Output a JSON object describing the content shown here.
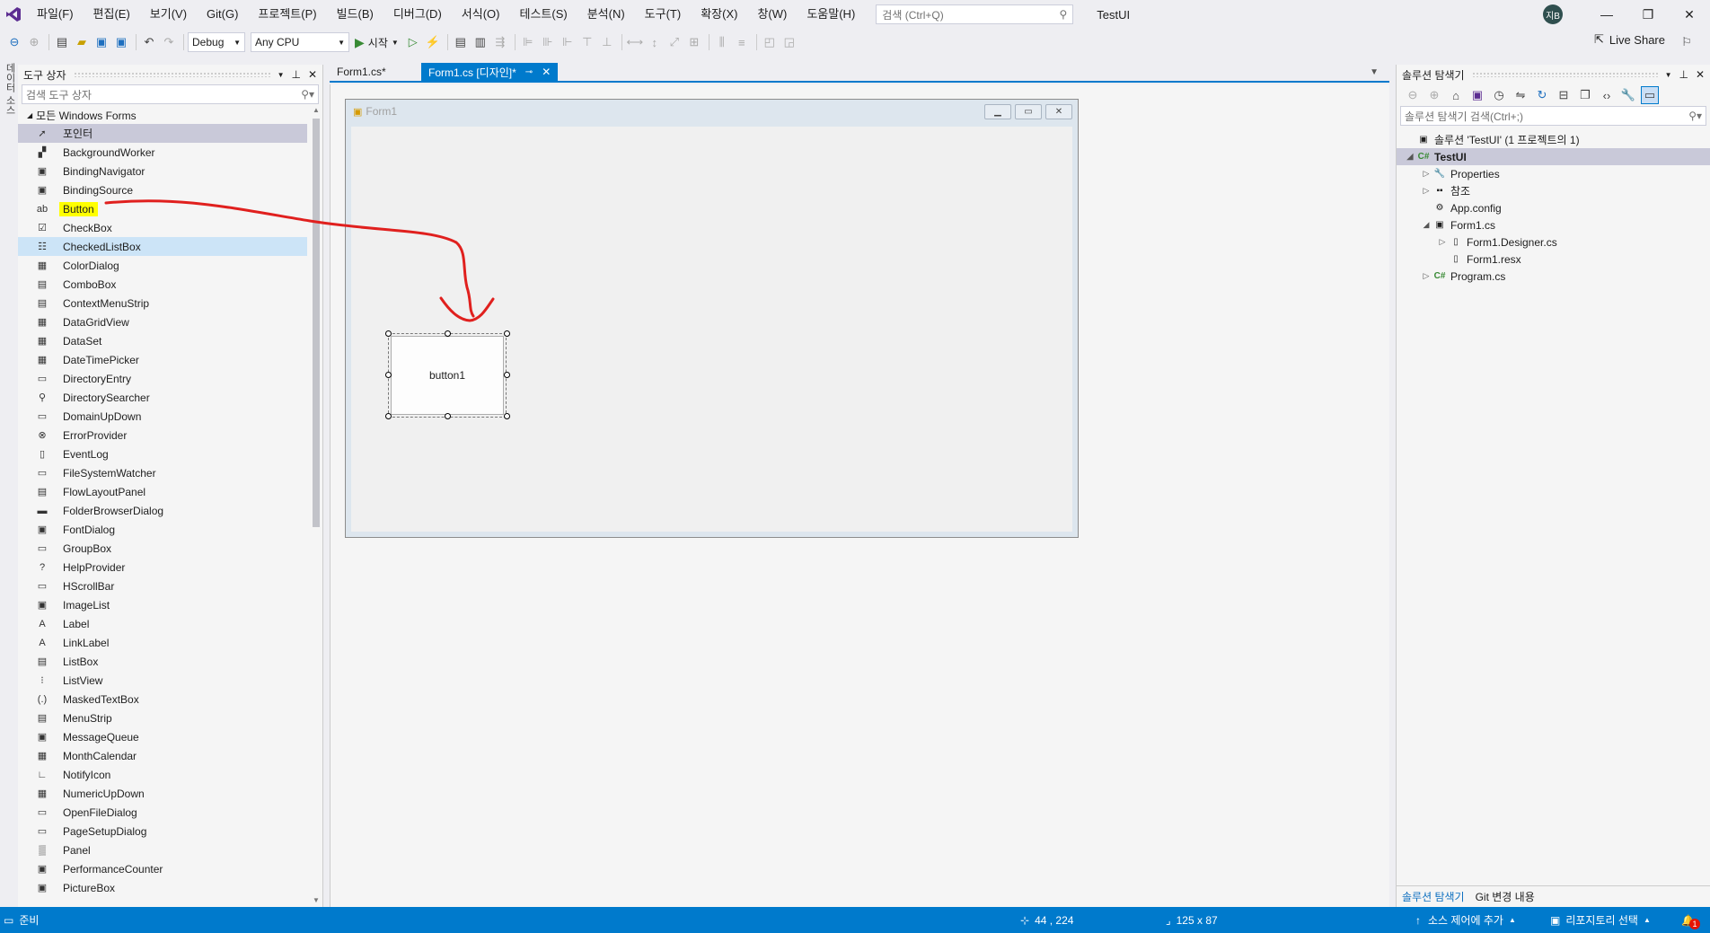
{
  "menu": {
    "items": [
      "파일(F)",
      "편집(E)",
      "보기(V)",
      "Git(G)",
      "프로젝트(P)",
      "빌드(B)",
      "디버그(D)",
      "서식(O)",
      "테스트(S)",
      "분석(N)",
      "도구(T)",
      "확장(X)",
      "창(W)",
      "도움말(H)"
    ],
    "search_placeholder": "검색 (Ctrl+Q)",
    "app_title": "TestUI",
    "avatar_initials": "지B"
  },
  "toolbar": {
    "config": "Debug",
    "platform": "Any CPU",
    "start_label": "시작",
    "live_share": "Live Share"
  },
  "left_strip": {
    "label": "데이터 소스"
  },
  "toolbox": {
    "title": "도구 상자",
    "search_placeholder": "검색 도구 상자",
    "section": "모든 Windows Forms",
    "items": [
      {
        "label": "포인터",
        "icon": "pointer-icon",
        "glyph": "➚"
      },
      {
        "label": "BackgroundWorker",
        "icon": "backgroundworker-icon",
        "glyph": "▞"
      },
      {
        "label": "BindingNavigator",
        "icon": "bindingnavigator-icon",
        "glyph": "▣"
      },
      {
        "label": "BindingSource",
        "icon": "bindingsource-icon",
        "glyph": "▣"
      },
      {
        "label": "Button",
        "icon": "button-icon",
        "glyph": "ab"
      },
      {
        "label": "CheckBox",
        "icon": "checkbox-icon",
        "glyph": "☑"
      },
      {
        "label": "CheckedListBox",
        "icon": "checkedlistbox-icon",
        "glyph": "☷"
      },
      {
        "label": "ColorDialog",
        "icon": "colordialog-icon",
        "glyph": "▦"
      },
      {
        "label": "ComboBox",
        "icon": "combobox-icon",
        "glyph": "▤"
      },
      {
        "label": "ContextMenuStrip",
        "icon": "contextmenustrip-icon",
        "glyph": "▤"
      },
      {
        "label": "DataGridView",
        "icon": "datagridview-icon",
        "glyph": "▦"
      },
      {
        "label": "DataSet",
        "icon": "dataset-icon",
        "glyph": "▦"
      },
      {
        "label": "DateTimePicker",
        "icon": "datetimepicker-icon",
        "glyph": "▦"
      },
      {
        "label": "DirectoryEntry",
        "icon": "directoryentry-icon",
        "glyph": "▭"
      },
      {
        "label": "DirectorySearcher",
        "icon": "directorysearcher-icon",
        "glyph": "⚲"
      },
      {
        "label": "DomainUpDown",
        "icon": "domainupdown-icon",
        "glyph": "▭"
      },
      {
        "label": "ErrorProvider",
        "icon": "errorprovider-icon",
        "glyph": "⊗"
      },
      {
        "label": "EventLog",
        "icon": "eventlog-icon",
        "glyph": "▯"
      },
      {
        "label": "FileSystemWatcher",
        "icon": "filesystemwatcher-icon",
        "glyph": "▭"
      },
      {
        "label": "FlowLayoutPanel",
        "icon": "flowlayoutpanel-icon",
        "glyph": "▤"
      },
      {
        "label": "FolderBrowserDialog",
        "icon": "folderbrowserdialog-icon",
        "glyph": "▬"
      },
      {
        "label": "FontDialog",
        "icon": "fontdialog-icon",
        "glyph": "▣"
      },
      {
        "label": "GroupBox",
        "icon": "groupbox-icon",
        "glyph": "▭"
      },
      {
        "label": "HelpProvider",
        "icon": "helpprovider-icon",
        "glyph": "?"
      },
      {
        "label": "HScrollBar",
        "icon": "hscrollbar-icon",
        "glyph": "▭"
      },
      {
        "label": "ImageList",
        "icon": "imagelist-icon",
        "glyph": "▣"
      },
      {
        "label": "Label",
        "icon": "label-icon",
        "glyph": "A"
      },
      {
        "label": "LinkLabel",
        "icon": "linklabel-icon",
        "glyph": "A"
      },
      {
        "label": "ListBox",
        "icon": "listbox-icon",
        "glyph": "▤"
      },
      {
        "label": "ListView",
        "icon": "listview-icon",
        "glyph": "⁝"
      },
      {
        "label": "MaskedTextBox",
        "icon": "maskedtextbox-icon",
        "glyph": "(.)"
      },
      {
        "label": "MenuStrip",
        "icon": "menustrip-icon",
        "glyph": "▤"
      },
      {
        "label": "MessageQueue",
        "icon": "messagequeue-icon",
        "glyph": "▣"
      },
      {
        "label": "MonthCalendar",
        "icon": "monthcalendar-icon",
        "glyph": "▦"
      },
      {
        "label": "NotifyIcon",
        "icon": "notifyicon-icon",
        "glyph": "∟"
      },
      {
        "label": "NumericUpDown",
        "icon": "numericupdown-icon",
        "glyph": "▦"
      },
      {
        "label": "OpenFileDialog",
        "icon": "openfiledialog-icon",
        "glyph": "▭"
      },
      {
        "label": "PageSetupDialog",
        "icon": "pagesetupdialog-icon",
        "glyph": "▭"
      },
      {
        "label": "Panel",
        "icon": "panel-icon",
        "glyph": "▒"
      },
      {
        "label": "PerformanceCounter",
        "icon": "performancecounter-icon",
        "glyph": "▣"
      },
      {
        "label": "PictureBox",
        "icon": "picturebox-icon",
        "glyph": "▣"
      }
    ]
  },
  "editor": {
    "tabs": [
      {
        "label": "Form1.cs*",
        "active": false
      },
      {
        "label": "Form1.cs [디자인]*",
        "active": true
      }
    ]
  },
  "form": {
    "title": "Form1",
    "button_text": "button1"
  },
  "solution": {
    "title": "솔루션 탐색기",
    "search_placeholder": "솔루션 탐색기 검색(Ctrl+;)",
    "tree": [
      {
        "label": "솔루션 'TestUI' (1 프로젝트의 1)",
        "icon": "solution-icon",
        "glyph": "▣",
        "arrow": "",
        "level": 0
      },
      {
        "label": "TestUI",
        "icon": "csharp-project-icon",
        "glyph": "C#",
        "arrow": "◢",
        "level": 0
      },
      {
        "label": "Properties",
        "icon": "wrench-icon",
        "glyph": "🔧",
        "arrow": "▷",
        "level": 1
      },
      {
        "label": "참조",
        "icon": "references-icon",
        "glyph": "▪▪",
        "arrow": "▷",
        "level": 1
      },
      {
        "label": "App.config",
        "icon": "config-icon",
        "glyph": "⚙",
        "arrow": "",
        "level": 1
      },
      {
        "label": "Form1.cs",
        "icon": "form-icon",
        "glyph": "▣",
        "arrow": "◢",
        "level": 1
      },
      {
        "label": "Form1.Designer.cs",
        "icon": "file-icon",
        "glyph": "▯",
        "arrow": "▷",
        "level": 2
      },
      {
        "label": "Form1.resx",
        "icon": "file-icon",
        "glyph": "▯",
        "arrow": "",
        "level": 2
      },
      {
        "label": "Program.cs",
        "icon": "csharp-file-icon",
        "glyph": "C#",
        "arrow": "▷",
        "level": 1
      }
    ],
    "bottom_tabs": [
      "솔루션 탐색기",
      "Git 변경 내용"
    ]
  },
  "status": {
    "ready": "준비",
    "position": "44 , 224",
    "size": "125 x 87",
    "source_control": "소스 제어에 추가",
    "repository": "리포지토리 선택",
    "notifications": "1"
  },
  "colors": {
    "accent": "#007acc",
    "highlight": "#ffff00",
    "annotation": "#e0201e"
  }
}
